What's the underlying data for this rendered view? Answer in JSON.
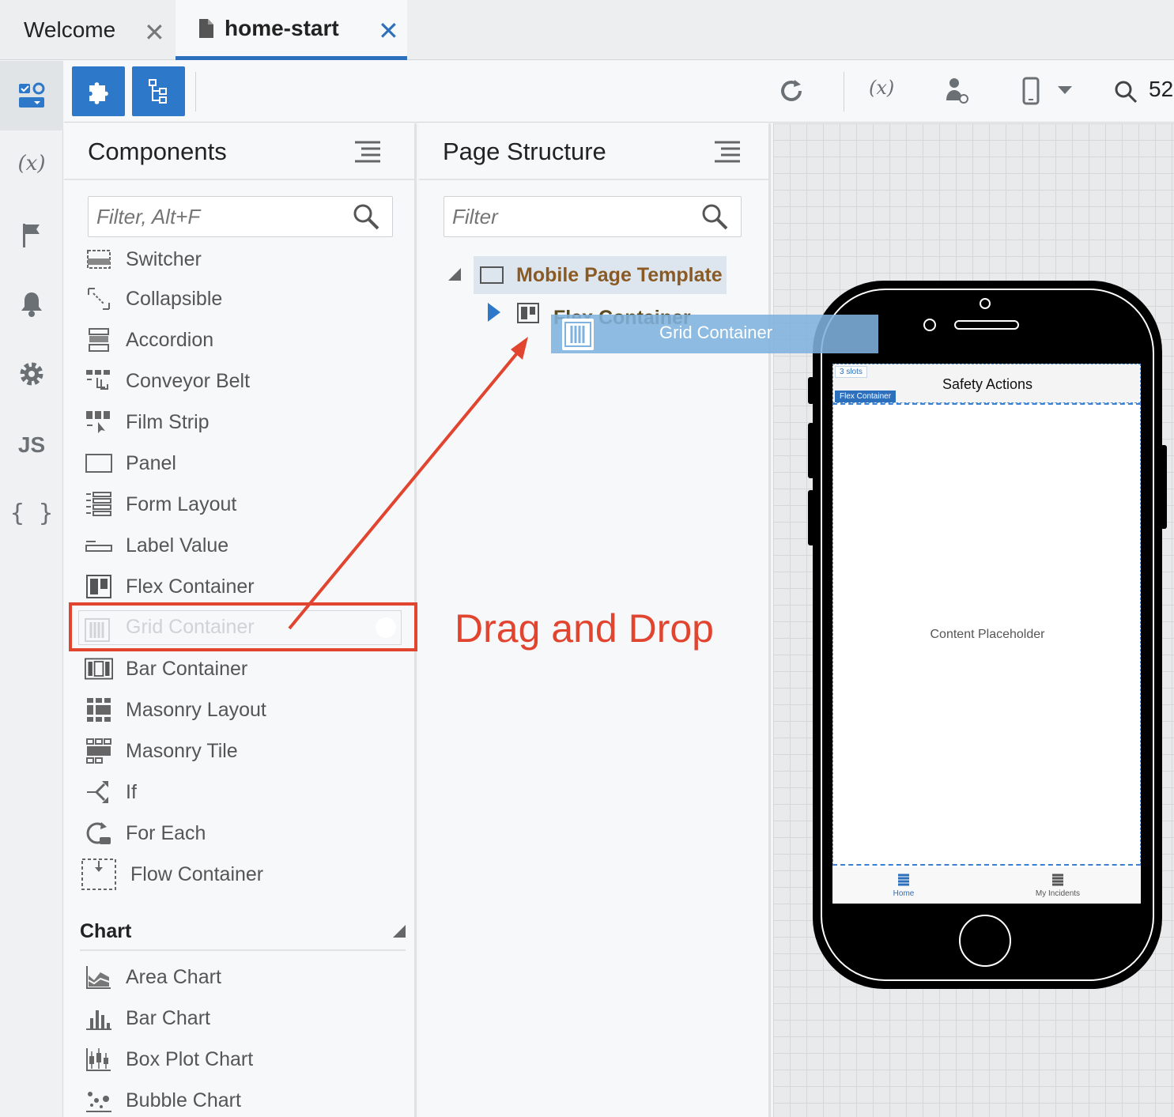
{
  "tabs": [
    {
      "label": "Welcome",
      "close": "✕"
    },
    {
      "label": "home-start",
      "close": "✕"
    }
  ],
  "toolbar": {
    "zoom_label": "52"
  },
  "components_panel": {
    "title": "Components",
    "filter_placeholder": "Filter, Alt+F",
    "items": [
      {
        "label": "Switcher",
        "icon": "switcher-icon"
      },
      {
        "label": "Collapsible",
        "icon": "collapsible-icon"
      },
      {
        "label": "Accordion",
        "icon": "accordion-icon"
      },
      {
        "label": "Conveyor Belt",
        "icon": "conveyor-belt-icon"
      },
      {
        "label": "Film Strip",
        "icon": "film-strip-icon"
      },
      {
        "label": "Panel",
        "icon": "panel-icon"
      },
      {
        "label": "Form Layout",
        "icon": "form-layout-icon"
      },
      {
        "label": "Label Value",
        "icon": "label-value-icon"
      },
      {
        "label": "Flex Container",
        "icon": "flex-container-icon"
      },
      {
        "label": "Grid Container",
        "icon": "grid-container-icon"
      },
      {
        "label": "Bar Container",
        "icon": "bar-container-icon"
      },
      {
        "label": "Masonry Layout",
        "icon": "masonry-layout-icon"
      },
      {
        "label": "Masonry Tile",
        "icon": "masonry-tile-icon"
      },
      {
        "label": "If",
        "icon": "if-icon"
      },
      {
        "label": "For Each",
        "icon": "for-each-icon"
      },
      {
        "label": "Flow Container",
        "icon": "flow-container-icon"
      }
    ],
    "chart_section": {
      "title": "Chart",
      "items": [
        {
          "label": "Area Chart",
          "icon": "area-chart-icon"
        },
        {
          "label": "Bar Chart",
          "icon": "bar-chart-icon"
        },
        {
          "label": "Box Plot Chart",
          "icon": "box-plot-chart-icon"
        },
        {
          "label": "Bubble Chart",
          "icon": "bubble-chart-icon"
        }
      ]
    }
  },
  "structure_panel": {
    "title": "Page Structure",
    "filter_placeholder": "Filter",
    "tree": [
      {
        "label": "Mobile Page Template",
        "expanded": true
      },
      {
        "label": "Flex Container",
        "expanded": false
      }
    ]
  },
  "drag_ghost": {
    "label": "Grid Container"
  },
  "annotation": {
    "text": "Drag and Drop",
    "color": "#e2452f"
  },
  "phone": {
    "slots_label": "3 slots",
    "flex_label": "Flex Container",
    "header_title": "Safety Actions",
    "content_placeholder": "Content Placeholder",
    "footer_tabs": [
      {
        "label": "Home"
      },
      {
        "label": "My Incidents"
      }
    ]
  },
  "colors": {
    "accent": "#2d78c8",
    "tree_label": "#8a5a24"
  }
}
